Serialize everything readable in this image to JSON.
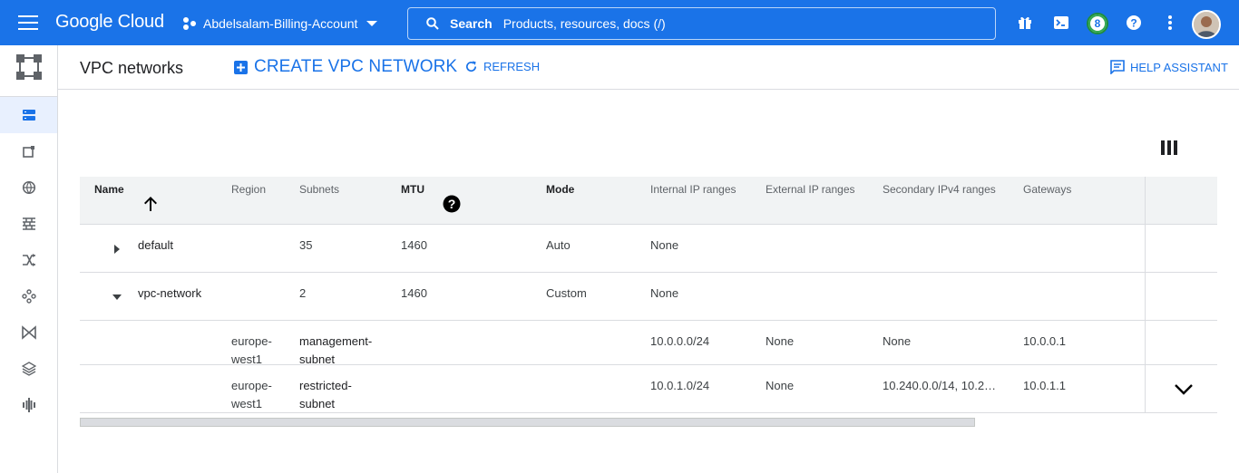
{
  "topbar": {
    "logo": "Google Cloud",
    "project": "Abdelsalam-Billing-Account",
    "search_label": "Search",
    "search_placeholder": "Products, resources, docs (/)",
    "notification_count": "8"
  },
  "page": {
    "title": "VPC networks",
    "create_label": "CREATE VPC NETWORK",
    "refresh_label": "REFRESH",
    "help_label": "HELP ASSISTANT"
  },
  "table": {
    "headers": {
      "name": "Name",
      "region": "Region",
      "subnets": "Subnets",
      "mtu": "MTU",
      "mode": "Mode",
      "internal": "Internal IP ranges",
      "external": "External IP ranges",
      "secondary": "Secondary IPv4 ranges",
      "gateways": "Gateways"
    },
    "rows": [
      {
        "name": "default",
        "subnets": "35",
        "mtu": "1460",
        "mode": "Auto",
        "internal": "None"
      },
      {
        "name": "vpc-network",
        "subnets": "2",
        "mtu": "1460",
        "mode": "Custom",
        "internal": "None"
      }
    ],
    "subnets": [
      {
        "region_a": "europe-",
        "region_b": "west1",
        "name_a": "management-",
        "name_b": "subnet",
        "internal": "10.0.0.0/24",
        "external": "None",
        "secondary": "None",
        "gateway": "10.0.0.1"
      },
      {
        "region_a": "europe-",
        "region_b": "west1",
        "name_a": "restricted-",
        "name_b": "subnet",
        "internal": "10.0.1.0/24",
        "external": "None",
        "secondary": "10.240.0.0/14, 10.2…",
        "gateway": "10.0.1.1"
      }
    ]
  },
  "colors": {
    "brand_blue": "#1a73e8",
    "header_bg": "#f1f3f4",
    "rail_active": "#e8f0fe"
  }
}
